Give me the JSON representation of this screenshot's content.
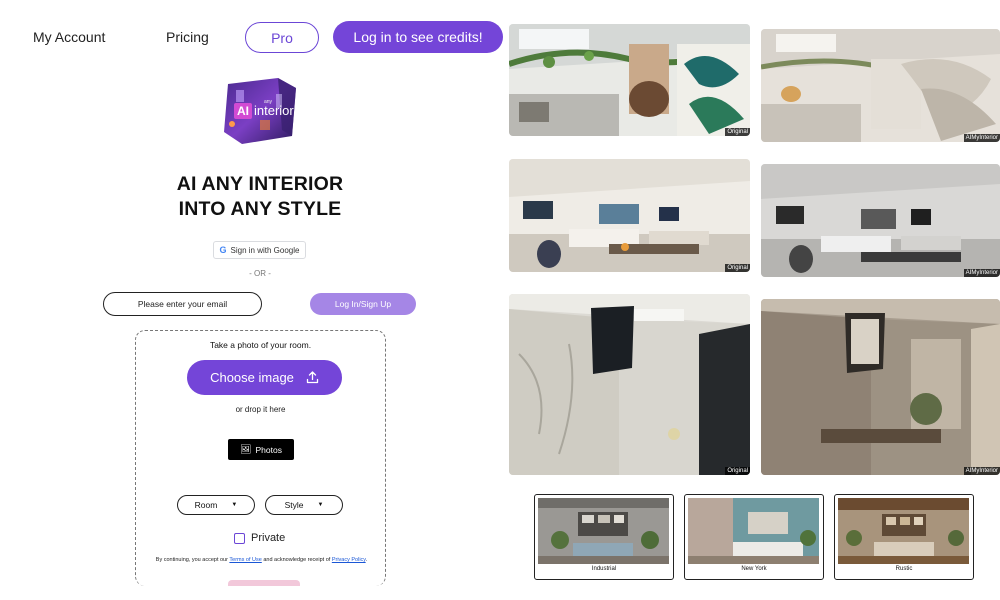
{
  "nav": {
    "account": "My Account",
    "pricing": "Pricing",
    "pro": "Pro",
    "login": "Log in to see credits!"
  },
  "logo": {
    "mark": "AI",
    "word": "interior",
    "small": "any"
  },
  "headline": {
    "line1": "AI ANY INTERIOR",
    "line2": "INTO ANY STYLE"
  },
  "auth": {
    "google_label": "Sign in with Google",
    "or": "- OR -",
    "email_placeholder": "Please enter your email",
    "signup_label": "Log In/Sign Up"
  },
  "upload": {
    "title": "Take a photo of your room.",
    "choose_label": "Choose image",
    "drop_label": "or drop it here",
    "photos_label": "Photos",
    "room_select": "Room",
    "style_select": "Style",
    "private_label": "Private",
    "terms_prefix": "By continuing, you accept our ",
    "terms_link": "Terms of Use",
    "terms_middle": " and acknowledge receipt of ",
    "privacy_link": "Privacy Policy",
    "terms_suffix": "."
  },
  "gallery": {
    "original_tag": "Original",
    "result_tag": "AIMyInterior"
  },
  "styles": [
    {
      "label": "Industrial"
    },
    {
      "label": "New York"
    },
    {
      "label": "Rustic"
    }
  ],
  "colors": {
    "accent": "#7445d8",
    "accent_light": "#a586e6"
  }
}
